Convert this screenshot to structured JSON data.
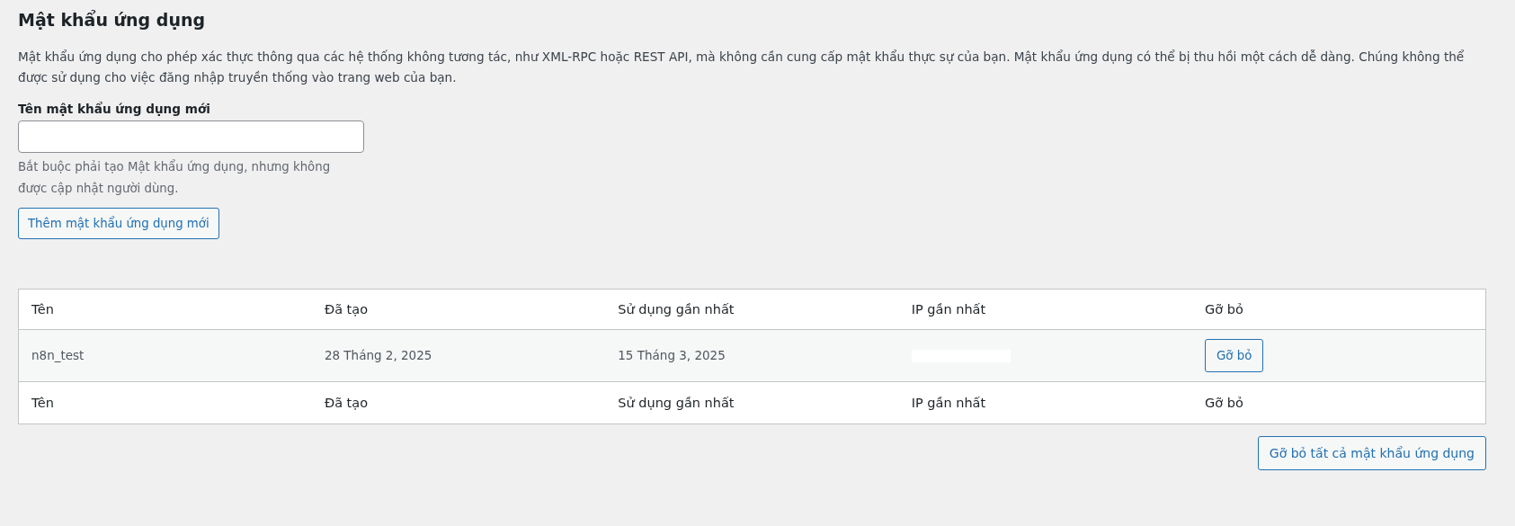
{
  "section": {
    "title": "Mật khẩu ứng dụng",
    "description": "Mật khẩu ứng dụng cho phép xác thực thông qua các hệ thống không tương tác, như XML-RPC hoặc REST API, mà không cần cung cấp mật khẩu thực sự của bạn. Mật khẩu ứng dụng có thể bị thu hồi một cách dễ dàng. Chúng không thể được sử dụng cho việc đăng nhập truyền thống vào trang web của bạn."
  },
  "new_password": {
    "label": "Tên mật khẩu ứng dụng mới",
    "hint": "Bắt buộc phải tạo Mật khẩu ứng dụng, nhưng không được cập nhật người dùng.",
    "button": "Thêm mật khẩu ứng dụng mới"
  },
  "table": {
    "columns": [
      "Tên",
      "Đã tạo",
      "Sử dụng gần nhất",
      "IP gần nhất",
      "Gỡ bỏ"
    ],
    "rows": [
      {
        "name": "n8n_test",
        "created": "28 Tháng 2, 2025",
        "last_used": "15 Tháng 3, 2025",
        "last_ip": {
          "kind": "redacted"
        },
        "action": "Gỡ bỏ"
      }
    ],
    "footer_columns": [
      "Tên",
      "Đã tạo",
      "Sử dụng gần nhất",
      "IP gần nhất",
      "Gỡ bỏ"
    ]
  },
  "remove_all_button": "Gỡ bỏ tất cả mật khẩu ứng dụng"
}
